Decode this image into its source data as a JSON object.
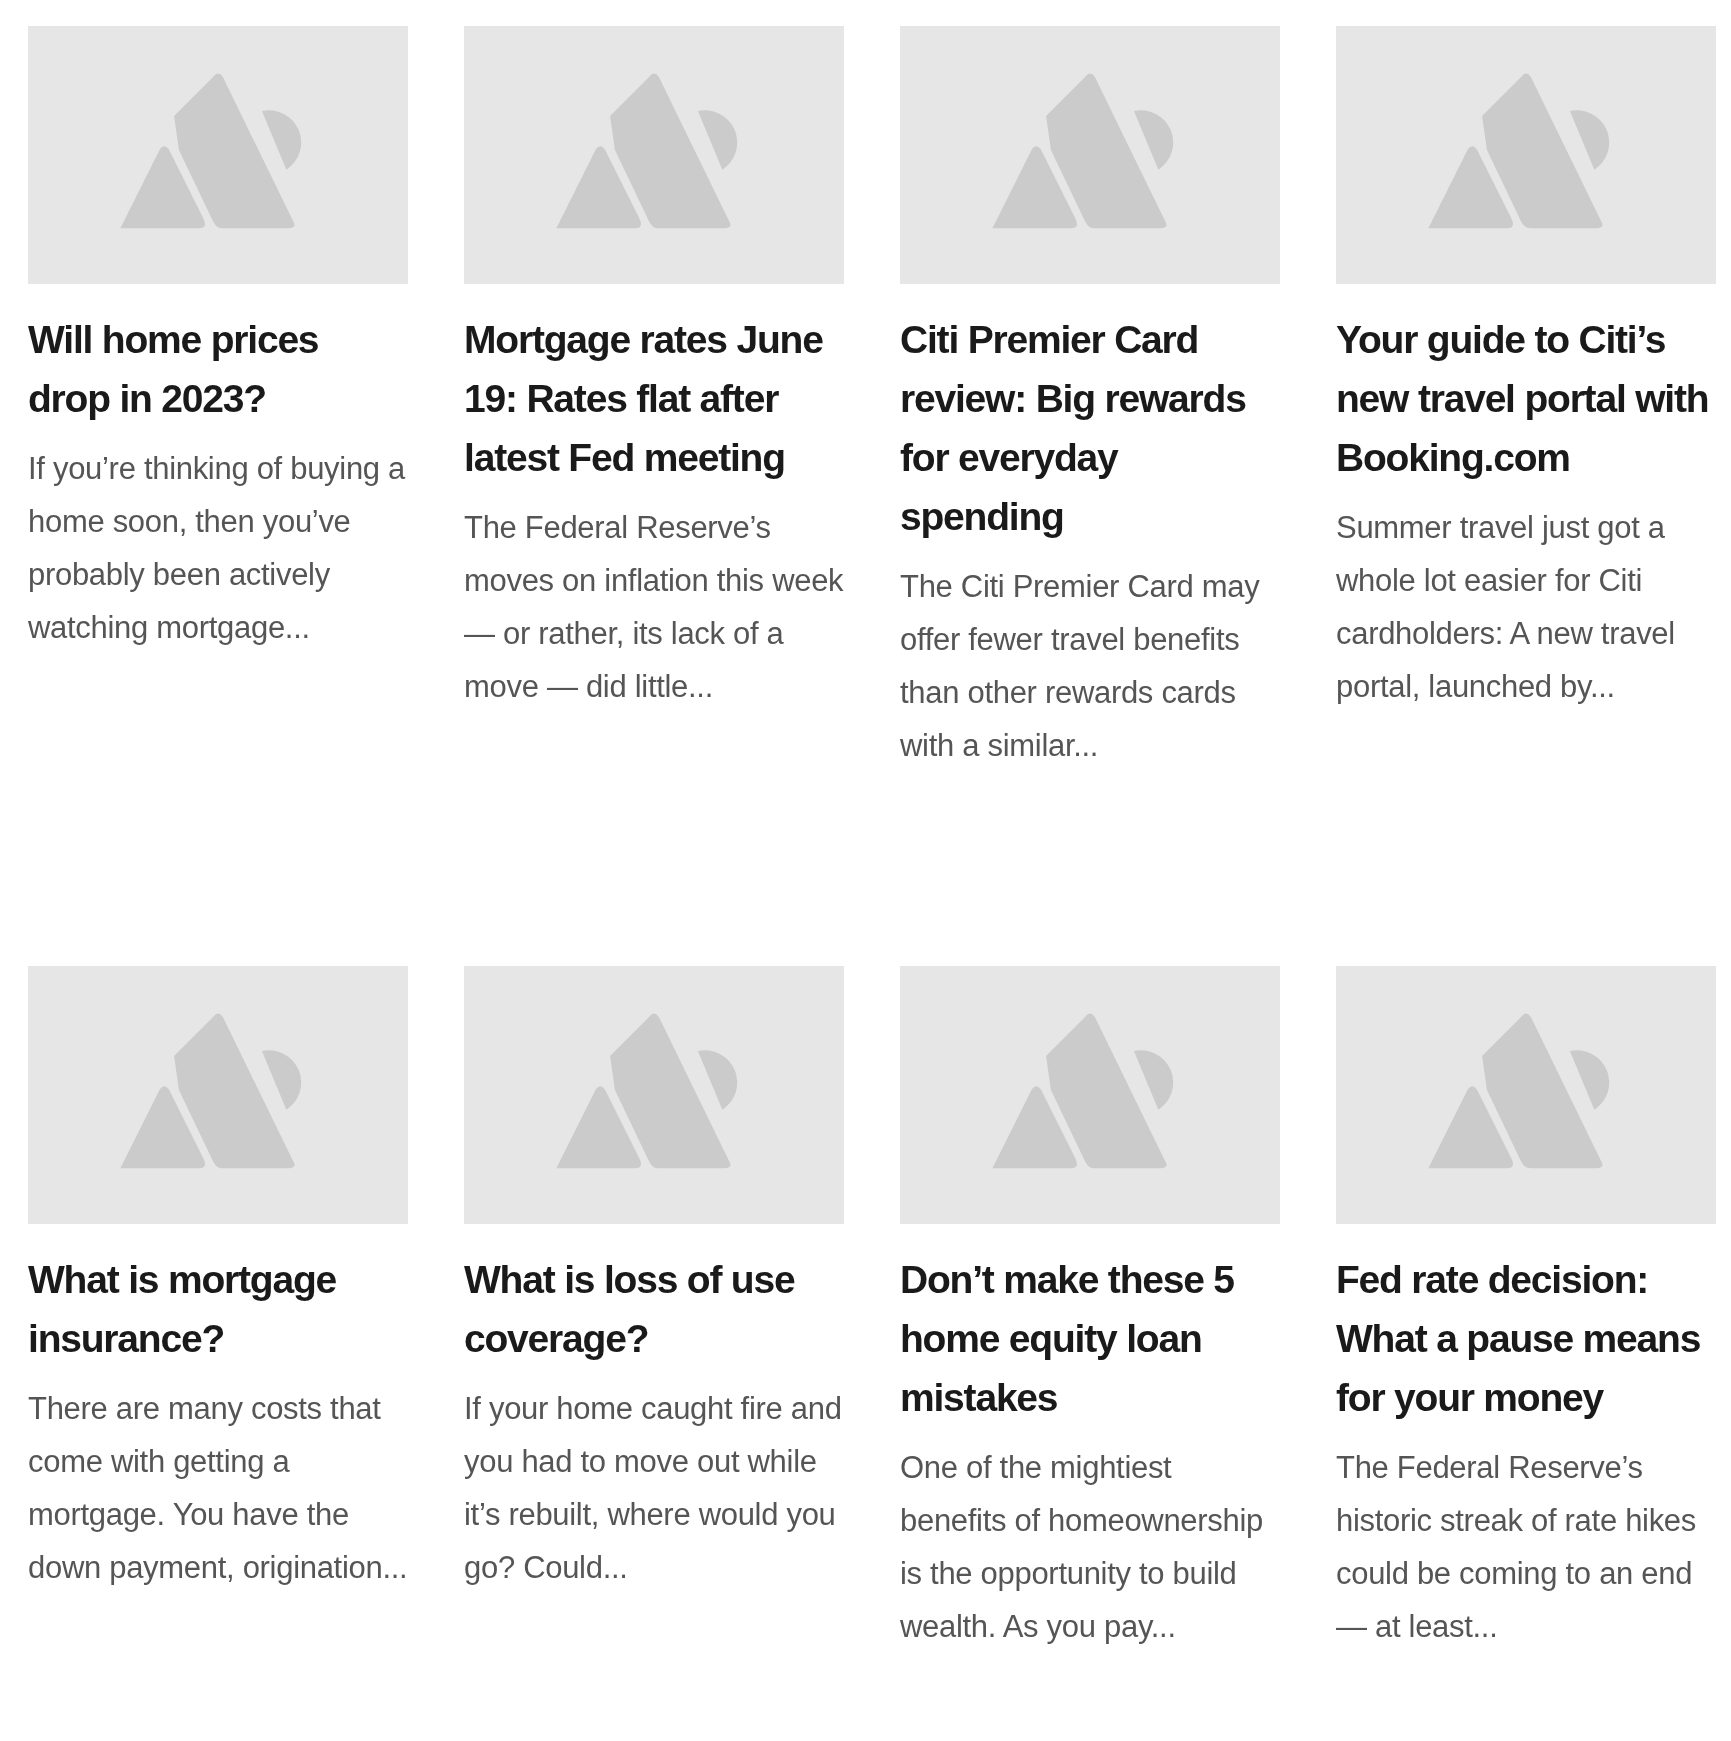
{
  "articles": [
    {
      "title": "Will home prices drop in 2023?",
      "summary": "If you’re thinking of buying a home soon, then you’ve probably been actively watching mortgage..."
    },
    {
      "title": "Mortgage rates June 19: Rates flat after latest Fed meeting",
      "summary": "The Federal Reserve’s moves on inflation this week — or rather, its lack of a move — did little..."
    },
    {
      "title": "Citi Premier Card review: Big rewards for everyday spending",
      "summary": "The Citi Premier Card may offer fewer travel benefits than other rewards cards with a similar..."
    },
    {
      "title": "Your guide to Citi’s new travel portal with Booking.com",
      "summary": "Summer travel just got a whole lot easier for Citi cardholders: A new travel portal, launched by..."
    },
    {
      "title": "What is mortgage insurance?",
      "summary": "There are many costs that come with getting a mortgage. You have the down payment, origination..."
    },
    {
      "title": "What is loss of use coverage?",
      "summary": "If your home caught fire and you had to move out while it’s rebuilt, where would you go? Could..."
    },
    {
      "title": "Don’t make these 5 home equity loan mistakes",
      "summary": "One of the mightiest benefits of homeownership is the opportunity to build wealth. As you pay..."
    },
    {
      "title": "Fed rate decision: What a pause means for your money",
      "summary": "The Federal Reserve’s historic streak of rate hikes could be coming to an end — at least..."
    }
  ]
}
